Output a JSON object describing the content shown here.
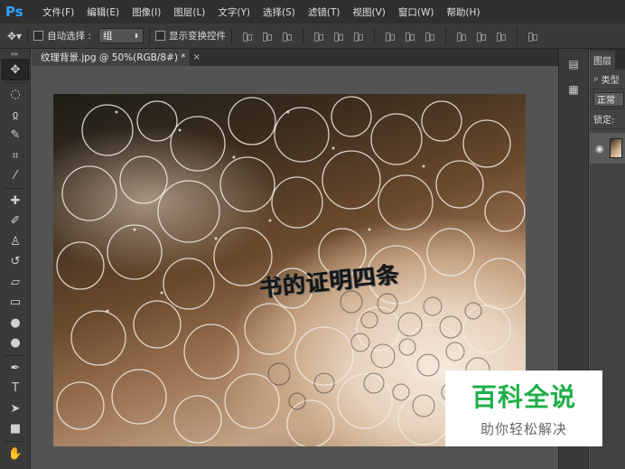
{
  "app": {
    "logo": "Ps"
  },
  "menu": [
    "文件(F)",
    "编辑(E)",
    "图像(I)",
    "图层(L)",
    "文字(Y)",
    "选择(S)",
    "滤镜(T)",
    "视图(V)",
    "窗口(W)",
    "帮助(H)"
  ],
  "options": {
    "auto_select_label": "自动选择 :",
    "auto_select_value": "组",
    "show_transform_label": "显示变换控件"
  },
  "document": {
    "tab_title": "纹理背景.jpg @ 50%(RGB/8#) *",
    "close_glyph": "×",
    "canvas_text": "书的证明四条"
  },
  "layers": {
    "tab_label": "图层",
    "kind_label": "类型",
    "blend_mode": "正常",
    "lock_label": "锁定:"
  },
  "watermark": {
    "title": "百科全说",
    "subtitle": "助你轻松解决"
  },
  "colors": {
    "ps_blue": "#2fa3ff",
    "watermark_green": "#1fae4a"
  }
}
